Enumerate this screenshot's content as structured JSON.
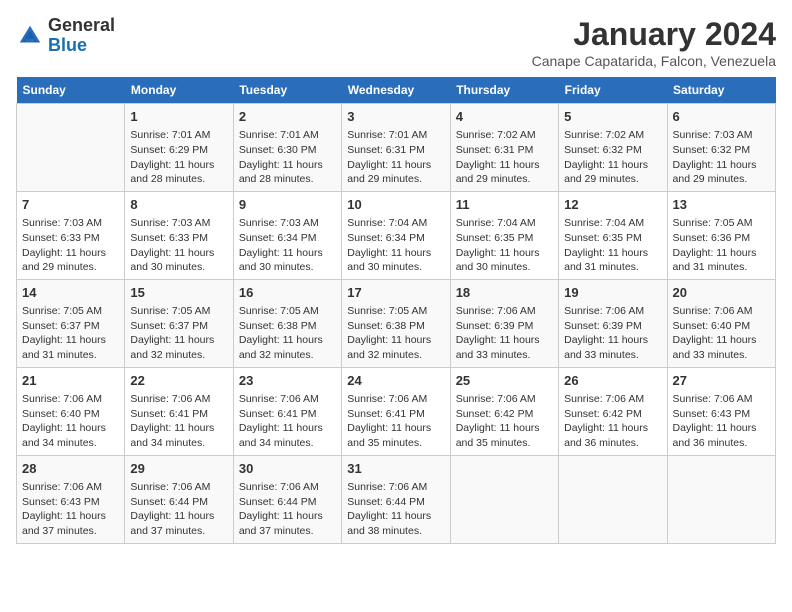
{
  "header": {
    "logo_general": "General",
    "logo_blue": "Blue",
    "month": "January 2024",
    "location": "Canape Capatarida, Falcon, Venezuela"
  },
  "weekdays": [
    "Sunday",
    "Monday",
    "Tuesday",
    "Wednesday",
    "Thursday",
    "Friday",
    "Saturday"
  ],
  "weeks": [
    [
      {
        "day": "",
        "content": ""
      },
      {
        "day": "1",
        "content": "Sunrise: 7:01 AM\nSunset: 6:29 PM\nDaylight: 11 hours and 28 minutes."
      },
      {
        "day": "2",
        "content": "Sunrise: 7:01 AM\nSunset: 6:30 PM\nDaylight: 11 hours and 28 minutes."
      },
      {
        "day": "3",
        "content": "Sunrise: 7:01 AM\nSunset: 6:31 PM\nDaylight: 11 hours and 29 minutes."
      },
      {
        "day": "4",
        "content": "Sunrise: 7:02 AM\nSunset: 6:31 PM\nDaylight: 11 hours and 29 minutes."
      },
      {
        "day": "5",
        "content": "Sunrise: 7:02 AM\nSunset: 6:32 PM\nDaylight: 11 hours and 29 minutes."
      },
      {
        "day": "6",
        "content": "Sunrise: 7:03 AM\nSunset: 6:32 PM\nDaylight: 11 hours and 29 minutes."
      }
    ],
    [
      {
        "day": "7",
        "content": "Sunrise: 7:03 AM\nSunset: 6:33 PM\nDaylight: 11 hours and 29 minutes."
      },
      {
        "day": "8",
        "content": "Sunrise: 7:03 AM\nSunset: 6:33 PM\nDaylight: 11 hours and 30 minutes."
      },
      {
        "day": "9",
        "content": "Sunrise: 7:03 AM\nSunset: 6:34 PM\nDaylight: 11 hours and 30 minutes."
      },
      {
        "day": "10",
        "content": "Sunrise: 7:04 AM\nSunset: 6:34 PM\nDaylight: 11 hours and 30 minutes."
      },
      {
        "day": "11",
        "content": "Sunrise: 7:04 AM\nSunset: 6:35 PM\nDaylight: 11 hours and 30 minutes."
      },
      {
        "day": "12",
        "content": "Sunrise: 7:04 AM\nSunset: 6:35 PM\nDaylight: 11 hours and 31 minutes."
      },
      {
        "day": "13",
        "content": "Sunrise: 7:05 AM\nSunset: 6:36 PM\nDaylight: 11 hours and 31 minutes."
      }
    ],
    [
      {
        "day": "14",
        "content": "Sunrise: 7:05 AM\nSunset: 6:37 PM\nDaylight: 11 hours and 31 minutes."
      },
      {
        "day": "15",
        "content": "Sunrise: 7:05 AM\nSunset: 6:37 PM\nDaylight: 11 hours and 32 minutes."
      },
      {
        "day": "16",
        "content": "Sunrise: 7:05 AM\nSunset: 6:38 PM\nDaylight: 11 hours and 32 minutes."
      },
      {
        "day": "17",
        "content": "Sunrise: 7:05 AM\nSunset: 6:38 PM\nDaylight: 11 hours and 32 minutes."
      },
      {
        "day": "18",
        "content": "Sunrise: 7:06 AM\nSunset: 6:39 PM\nDaylight: 11 hours and 33 minutes."
      },
      {
        "day": "19",
        "content": "Sunrise: 7:06 AM\nSunset: 6:39 PM\nDaylight: 11 hours and 33 minutes."
      },
      {
        "day": "20",
        "content": "Sunrise: 7:06 AM\nSunset: 6:40 PM\nDaylight: 11 hours and 33 minutes."
      }
    ],
    [
      {
        "day": "21",
        "content": "Sunrise: 7:06 AM\nSunset: 6:40 PM\nDaylight: 11 hours and 34 minutes."
      },
      {
        "day": "22",
        "content": "Sunrise: 7:06 AM\nSunset: 6:41 PM\nDaylight: 11 hours and 34 minutes."
      },
      {
        "day": "23",
        "content": "Sunrise: 7:06 AM\nSunset: 6:41 PM\nDaylight: 11 hours and 34 minutes."
      },
      {
        "day": "24",
        "content": "Sunrise: 7:06 AM\nSunset: 6:41 PM\nDaylight: 11 hours and 35 minutes."
      },
      {
        "day": "25",
        "content": "Sunrise: 7:06 AM\nSunset: 6:42 PM\nDaylight: 11 hours and 35 minutes."
      },
      {
        "day": "26",
        "content": "Sunrise: 7:06 AM\nSunset: 6:42 PM\nDaylight: 11 hours and 36 minutes."
      },
      {
        "day": "27",
        "content": "Sunrise: 7:06 AM\nSunset: 6:43 PM\nDaylight: 11 hours and 36 minutes."
      }
    ],
    [
      {
        "day": "28",
        "content": "Sunrise: 7:06 AM\nSunset: 6:43 PM\nDaylight: 11 hours and 37 minutes."
      },
      {
        "day": "29",
        "content": "Sunrise: 7:06 AM\nSunset: 6:44 PM\nDaylight: 11 hours and 37 minutes."
      },
      {
        "day": "30",
        "content": "Sunrise: 7:06 AM\nSunset: 6:44 PM\nDaylight: 11 hours and 37 minutes."
      },
      {
        "day": "31",
        "content": "Sunrise: 7:06 AM\nSunset: 6:44 PM\nDaylight: 11 hours and 38 minutes."
      },
      {
        "day": "",
        "content": ""
      },
      {
        "day": "",
        "content": ""
      },
      {
        "day": "",
        "content": ""
      }
    ]
  ]
}
